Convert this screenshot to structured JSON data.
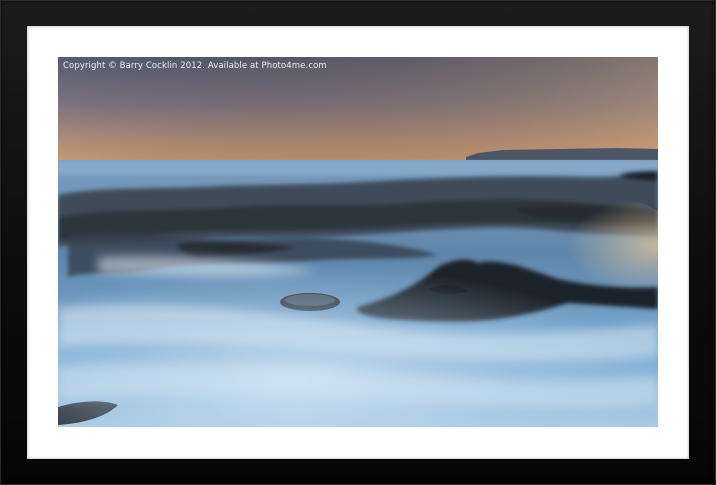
{
  "watermark": {
    "text": "Copyright © Barry Cocklin 2012. Available at Photo4me.com"
  },
  "colors": {
    "frame": "#111111",
    "mount": "#ffffff",
    "sky_top": "#5e6178",
    "sky_horizon": "#c0936a",
    "sea": "#6fa0c8",
    "rock": "#2e343c"
  },
  "scene": {
    "subject": "long-exposure seascape over rock shelf at dusk",
    "icon": "framed-print"
  }
}
